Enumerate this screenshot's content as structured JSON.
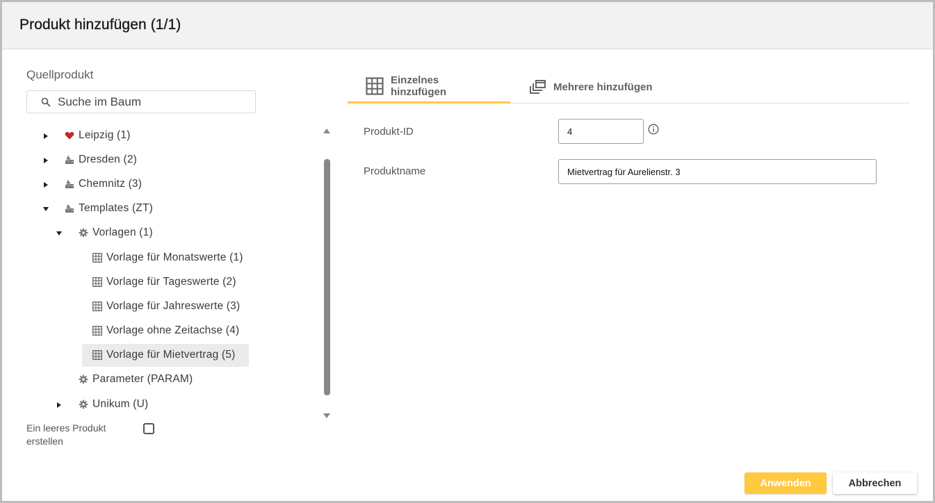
{
  "dialog": {
    "title": "Produkt hinzufügen (1/1)"
  },
  "source": {
    "label": "Quellprodukt",
    "search_placeholder": "Suche im Baum"
  },
  "tree": [
    {
      "label": "Leipzig (1)",
      "icon": "heart-icon",
      "toggle": "collapsed"
    },
    {
      "label": "Dresden (2)",
      "icon": "building-icon",
      "toggle": "collapsed"
    },
    {
      "label": "Chemnitz (3)",
      "icon": "building-icon",
      "toggle": "collapsed"
    },
    {
      "label": "Templates (ZT)",
      "icon": "building-icon",
      "toggle": "expanded"
    },
    {
      "label": "Vorlagen (1)",
      "icon": "gear-icon",
      "toggle": "expanded"
    },
    {
      "label": "Vorlage für Monatswerte (1)",
      "icon": "grid-icon",
      "toggle": "none"
    },
    {
      "label": "Vorlage für Tageswerte (2)",
      "icon": "grid-icon",
      "toggle": "none"
    },
    {
      "label": "Vorlage für Jahreswerte (3)",
      "icon": "grid-icon",
      "toggle": "none"
    },
    {
      "label": "Vorlage ohne Zeitachse (4)",
      "icon": "grid-icon",
      "toggle": "none"
    },
    {
      "label": "Vorlage für Mietvertrag (5)",
      "icon": "grid-icon",
      "toggle": "none",
      "selected": true
    },
    {
      "label": "Parameter (PARAM)",
      "icon": "gear-icon",
      "toggle": "none"
    },
    {
      "label": "Unikum (U)",
      "icon": "gear-icon",
      "toggle": "collapsed"
    }
  ],
  "empty_product": {
    "label": "Ein leeres Produkt erstellen",
    "checked": false
  },
  "tabs": [
    {
      "label": "Einzelnes hinzufügen",
      "icon": "grid-icon",
      "active": true
    },
    {
      "label": "Mehrere hinzufügen",
      "icon": "stacked-windows-icon",
      "active": false
    }
  ],
  "form": {
    "product_id_label": "Produkt-ID",
    "product_id_value": "4",
    "product_name_label": "Produktname",
    "product_name_value": "Mietvertrag für Aurelienstr. 3"
  },
  "buttons": {
    "apply": "Anwenden",
    "cancel": "Abbrechen"
  },
  "colors": {
    "accent": "#ffc940",
    "heart": "#c62828"
  }
}
